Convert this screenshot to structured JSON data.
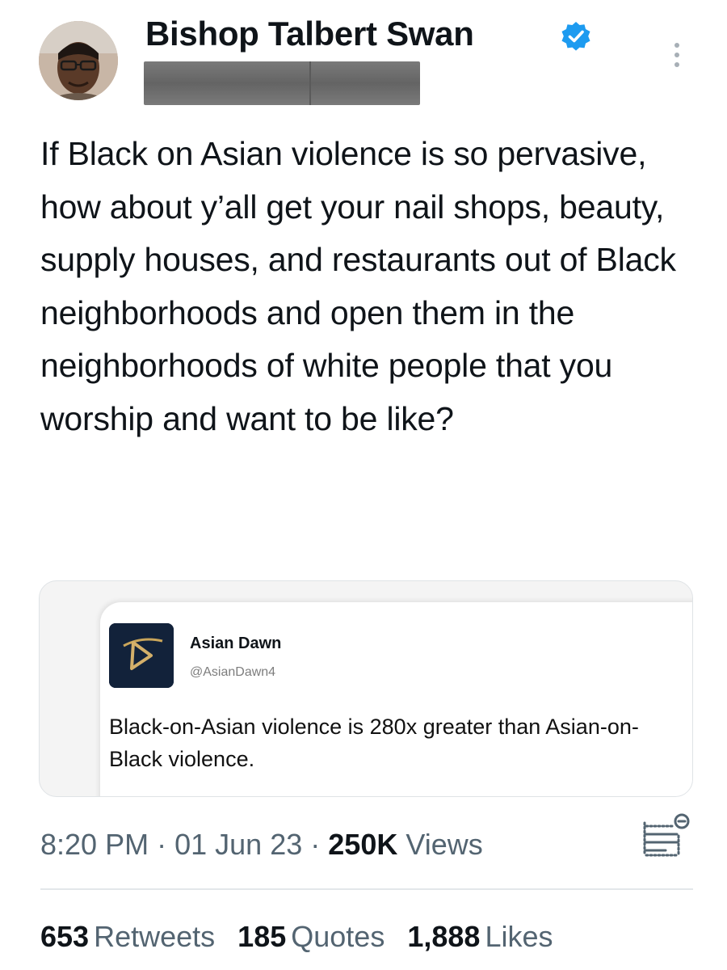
{
  "tweet": {
    "author": {
      "display_name": "Bishop Talbert Swan",
      "verified_icon": "verified-badge-icon",
      "avatar_icon": "profile-photo"
    },
    "text": "If Black on Asian violence is so pervasive, how about y’all get your nail shops, beauty, supply houses, and restaurants out of Black neighborhoods and open them in the neighborhoods of white people that you worship and want to be like?",
    "quoted": {
      "name": "Asian Dawn",
      "handle": "@AsianDawn4",
      "text": "Black-on-Asian violence is 280x greater than Asian-on-Black violence."
    },
    "meta": {
      "time": "8:20 PM",
      "sep1": "·",
      "date": "01 Jun 23",
      "sep2": "·",
      "views_count": "250K",
      "views_label": "Views"
    },
    "stats": {
      "retweets_count": "653",
      "retweets_label": "Retweets",
      "quotes_count": "185",
      "quotes_label": "Quotes",
      "likes_count": "1,888",
      "likes_label": "Likes"
    }
  },
  "colors": {
    "verified_blue": "#1d9bf0",
    "text_primary": "#0f1419",
    "text_secondary": "#536471"
  }
}
